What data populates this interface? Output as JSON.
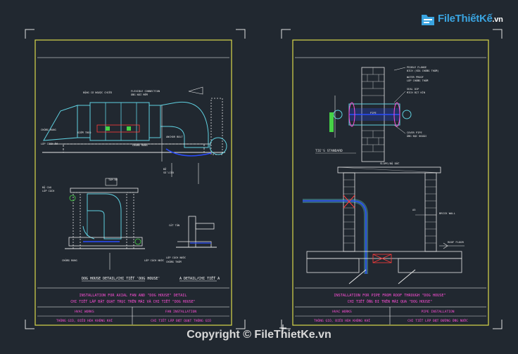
{
  "logo": {
    "text_main": "FileThiếtKế",
    "text_suffix": ".vn",
    "icon": "file-folder-icon"
  },
  "copyright": "Copyright © FileThietKe.vn",
  "colors": {
    "background": "#212830",
    "frame": "#d9d94a",
    "cyan": "#5fd0e0",
    "blue": "#2a4dff",
    "red": "#ff3b3b",
    "magenta": "#ff4fd8",
    "text": "#e8e8e8",
    "green": "#46d246"
  },
  "left_sheet": {
    "ann_fan_1": "ĐỘNG CƠ NGƯỢC CHIỀU",
    "ann_fan_2": "FLEXIBLE CONNECTION",
    "ann_fan_3": "ỐNG NỐI MỀM",
    "ann_fan_4": "ANCHOR BOLT",
    "ann_left_1": "CHỐNG RUNG",
    "ann_left_2": "LỚP CÁCH ÂM",
    "ann_mid_1": "ĐIỂM TREO",
    "ann_mid_2": "CHỐNG RUNG",
    "ann_bottom_1": "ĐỠ",
    "ann_bottom_2": "SỐ LIỆU",
    "dh_label_1": "ĐỘ CAO",
    "dh_label_2": "LỐP CÁCH",
    "dh_right_1": "TAM ĐỠ",
    "dh_right_2": "LỚP CÁCH NƯỚC",
    "detail_a_1": "CẮT TÔN",
    "detail_a_2": "LỚP CÁCH NƯỚC",
    "detail_a_3": "CHỐNG THẤM",
    "caption_left": "DOG HOUSE DETAIL/CHI TIẾT 'DOG HOUSE'",
    "caption_right": "A DETAIL/CHI TIẾT A",
    "title_en": "INSTALLATION FOR AXIAL FAN AND \"DOG HOUSE\" DETAIL",
    "title_vn": "CHI TIẾT LẮP ĐẶT QUẠT TRỤC TRÊN MÁI VÀ CHI TIẾT \"DOG HOUSE\"",
    "tb_left_1": "HVAC WORKS",
    "tb_left_2": "THÔNG GIÓ, ĐIỀU HÒA KHÔNG KHÍ",
    "tb_right_1": "FAN INSTALLATION",
    "tb_right_2": "CHI TIẾT LẮP ĐẶT QUẠT THÔNG GIÓ"
  },
  "right_sheet": {
    "ann_1": "PEOBLE FLANGE",
    "ann_2": "BÍCH (VỮA CHỐNG THẤM)",
    "ann_3": "WATER PROOF",
    "ann_4": "LỚP CHỐNG THẤM",
    "ann_5": "SEAL DIP",
    "ann_6": "MÍCH BỊT KÍN",
    "ann_7": "COVER PIPE",
    "ann_8": "ỐNG BỌC NGOÀI",
    "pipe_label": "PIPE",
    "standard_label": "TIE'S STANDARD",
    "slab_label": "SLOPE/ĐỘ DỐC",
    "brick_label": "BRICK WALL",
    "roof_label": "ROOF FLOOR",
    "dim_label": "A5",
    "title_en": "INSTALLATION FOR PIPE FROM ROOF THROUGH \"DOG HOUSE\"",
    "title_vn": "CHI TIẾT ỐNG ĐI TRÊN MÁI QUA \"DOG HOUSE\"",
    "tb_left_1": "HVAC WORKS",
    "tb_left_2": "THÔNG GIÓ, ĐIỀU HÒA KHÔNG KHÍ",
    "tb_right_1": "PIPE INSTALLATION",
    "tb_right_2": "CHI TIẾT LẮP ĐẶT ĐƯỜNG ỐNG NƯỚC"
  }
}
